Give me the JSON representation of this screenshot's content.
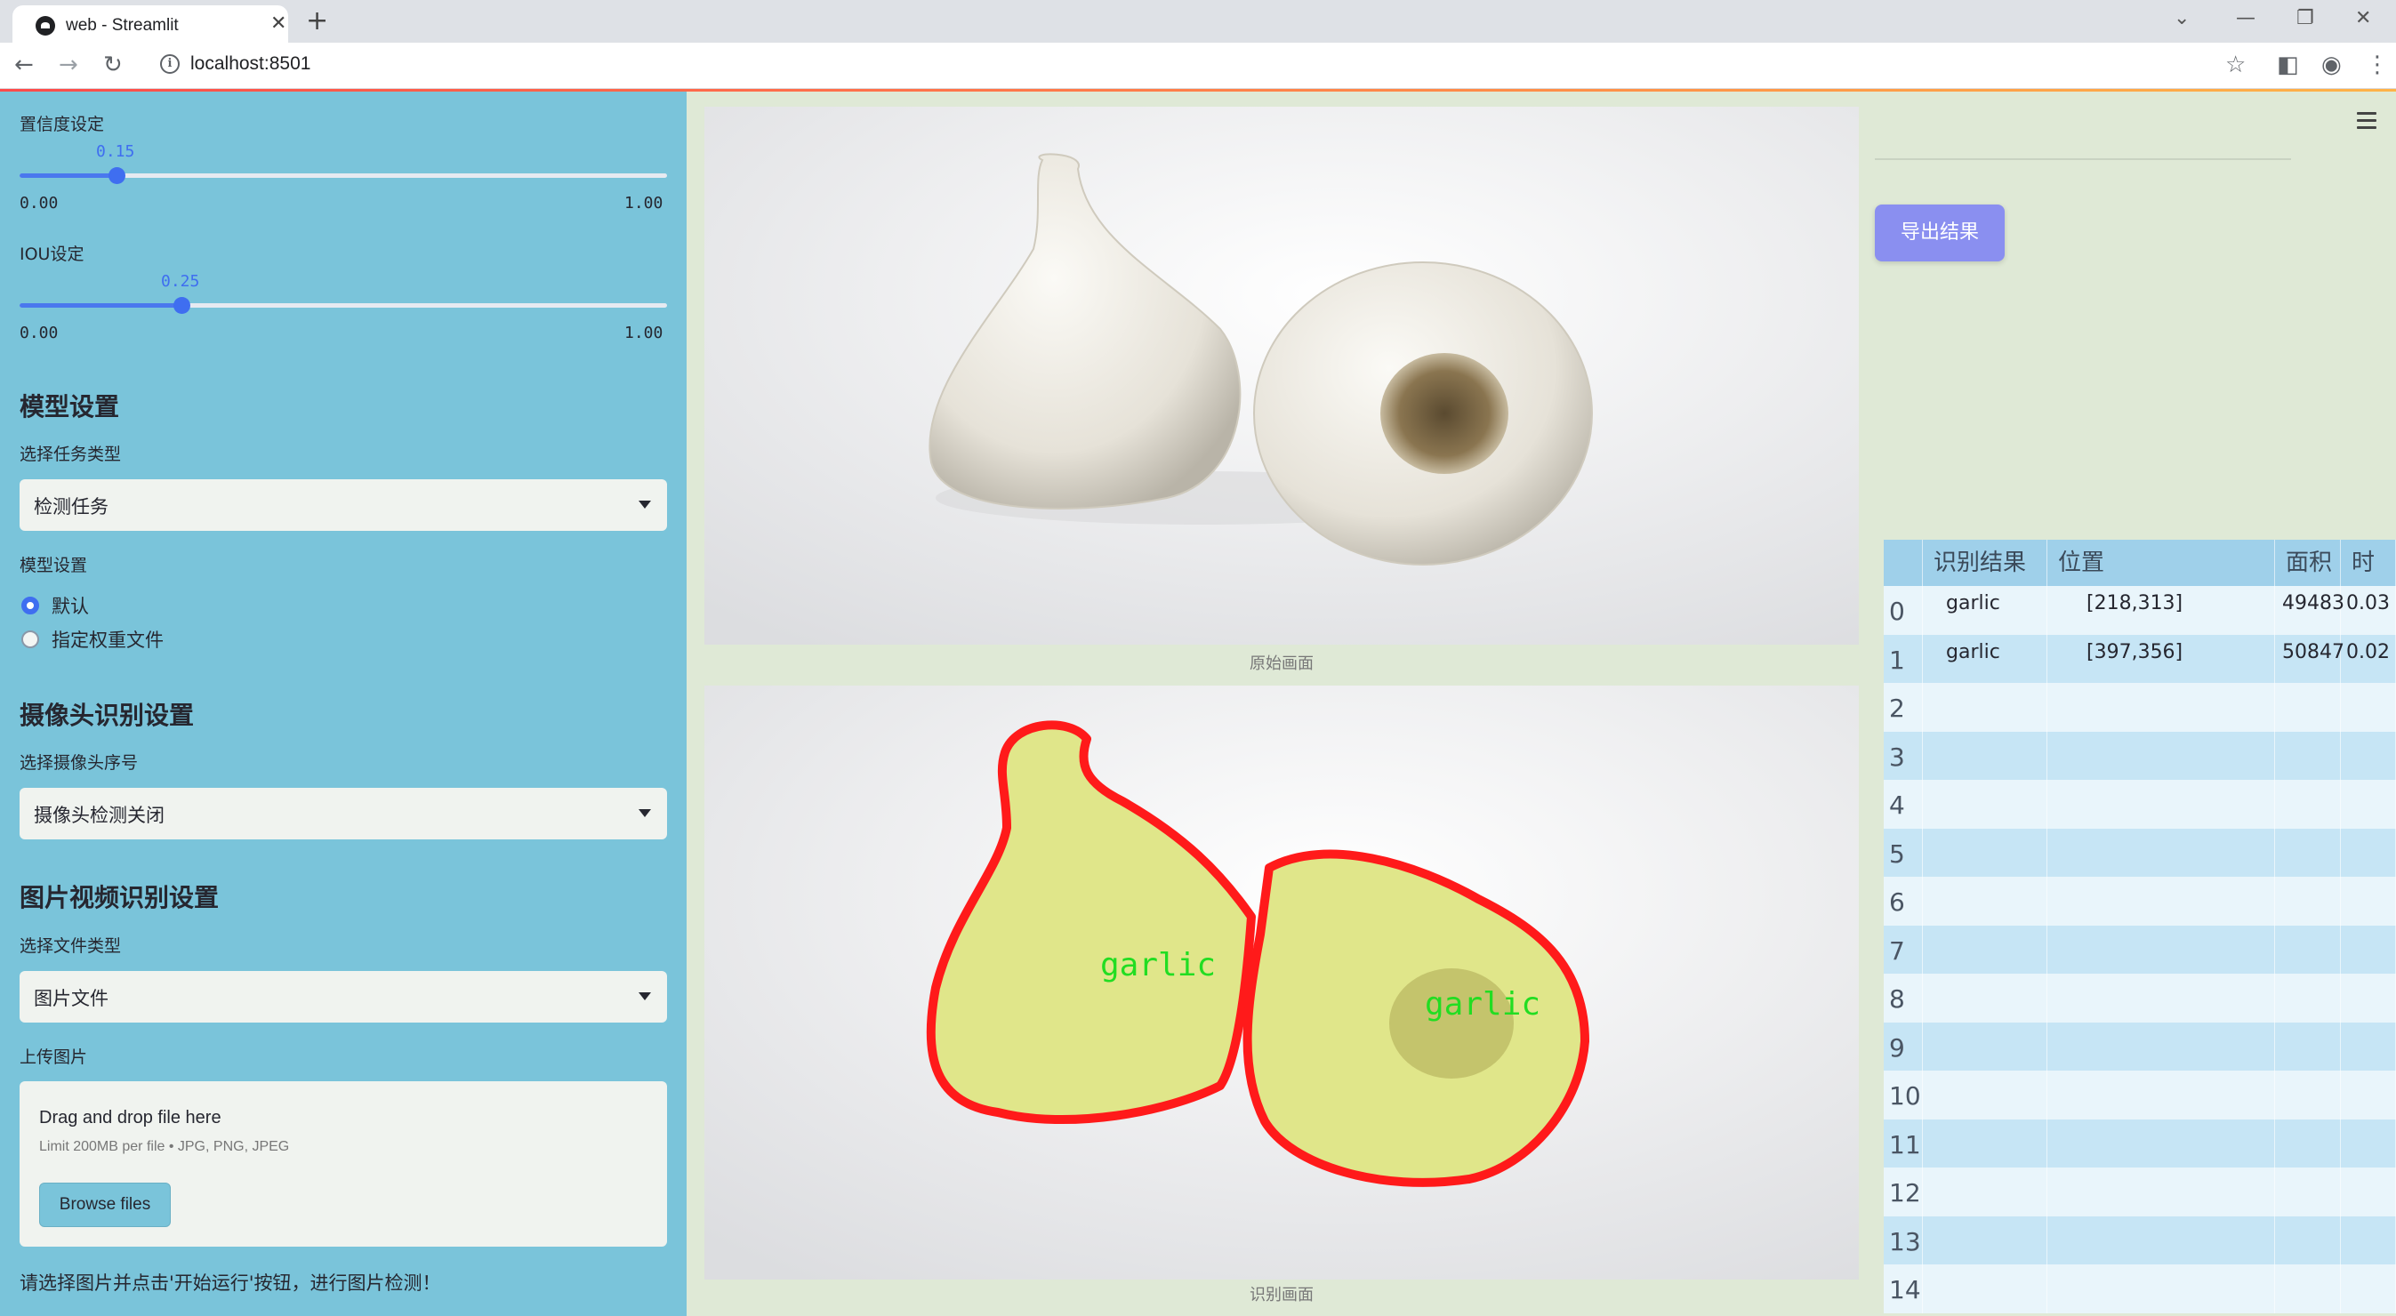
{
  "browser": {
    "tab_title": "web - Streamlit",
    "url": "localhost:8501"
  },
  "sidebar": {
    "confidence": {
      "label": "置信度设定",
      "value": "0.15",
      "value_num": 0.15,
      "min": "0.00",
      "max": "1.00"
    },
    "iou": {
      "label": "IOU设定",
      "value": "0.25",
      "value_num": 0.25,
      "min": "0.00",
      "max": "1.00"
    },
    "model_section": {
      "title": "模型设置",
      "task_label": "选择任务类型",
      "task_value": "检测任务",
      "model_label": "模型设置",
      "radio_default": "默认",
      "radio_custom": "指定权重文件",
      "selected": "默认"
    },
    "camera_section": {
      "title": "摄像头识别设置",
      "camera_label": "选择摄像头序号",
      "camera_value": "摄像头检测关闭"
    },
    "file_section": {
      "title": "图片视频识别设置",
      "type_label": "选择文件类型",
      "type_value": "图片文件",
      "upload_label": "上传图片",
      "drag_text": "Drag and drop file here",
      "limit_text": "Limit 200MB per file • JPG, PNG, JPEG",
      "browse_label": "Browse files"
    },
    "footnote": "请选择图片并点击'开始运行'按钮，进行图片检测！"
  },
  "main": {
    "original_caption": "原始画面",
    "result_caption": "识别画面",
    "detection_labels": [
      "garlic",
      "garlic"
    ]
  },
  "right": {
    "export_label": "导出结果",
    "table": {
      "headers": [
        "识别结果",
        "位置",
        "面积",
        "时间"
      ],
      "rows": [
        {
          "index": "0",
          "result": "garlic",
          "position": "[218,313]",
          "area": "49483",
          "time": "0.03"
        },
        {
          "index": "1",
          "result": "garlic",
          "position": "[397,356]",
          "area": "50847",
          "time": "0.02"
        },
        {
          "index": "2",
          "result": "",
          "position": "",
          "area": "",
          "time": ""
        },
        {
          "index": "3",
          "result": "",
          "position": "",
          "area": "",
          "time": ""
        },
        {
          "index": "4",
          "result": "",
          "position": "",
          "area": "",
          "time": ""
        },
        {
          "index": "5",
          "result": "",
          "position": "",
          "area": "",
          "time": ""
        },
        {
          "index": "6",
          "result": "",
          "position": "",
          "area": "",
          "time": ""
        },
        {
          "index": "7",
          "result": "",
          "position": "",
          "area": "",
          "time": ""
        },
        {
          "index": "8",
          "result": "",
          "position": "",
          "area": "",
          "time": ""
        },
        {
          "index": "9",
          "result": "",
          "position": "",
          "area": "",
          "time": ""
        },
        {
          "index": "10",
          "result": "",
          "position": "",
          "area": "",
          "time": ""
        },
        {
          "index": "11",
          "result": "",
          "position": "",
          "area": "",
          "time": ""
        },
        {
          "index": "12",
          "result": "",
          "position": "",
          "area": "",
          "time": ""
        },
        {
          "index": "13",
          "result": "",
          "position": "",
          "area": "",
          "time": ""
        },
        {
          "index": "14",
          "result": "",
          "position": "",
          "area": "",
          "time": ""
        }
      ]
    }
  },
  "colors": {
    "sidebar_bg": "#7ac4da",
    "main_bg": "#dfe9d6",
    "accent": "#3f6ef0",
    "export_button": "#8a8ff0",
    "mask_fill": "#e0e68a",
    "mask_outline": "#ff1a1a",
    "label_text": "#22dd22"
  }
}
